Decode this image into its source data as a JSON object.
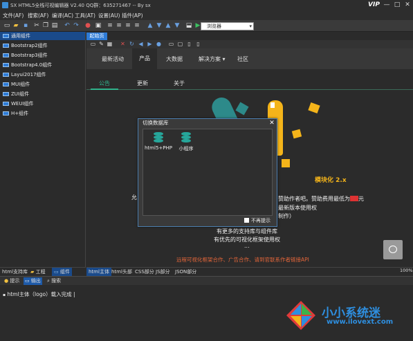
{
  "window": {
    "title": "SX HTML5全栈可视编辑器 V2.40 QQ群：635271467 -- By sx",
    "vip_label": "VIP",
    "controls": [
      "—",
      "□",
      "✕"
    ]
  },
  "menu": [
    "文件(AF)",
    "搜索(AF)",
    "编译(AC)",
    "工具(AT)",
    "设置(AU)",
    "插件(AP)"
  ],
  "toolbar": {
    "browser_select": "浏览器"
  },
  "sidebar": {
    "items": [
      {
        "label": "通用组件"
      },
      {
        "label": "Bootstrap2组件"
      },
      {
        "label": "Bootstrap3组件"
      },
      {
        "label": "Bootstrap4.0组件"
      },
      {
        "label": "Layui2017组件"
      },
      {
        "label": "MUI组件"
      },
      {
        "label": "ZUI组件"
      },
      {
        "label": "WEUI组件"
      },
      {
        "label": "H+组件"
      }
    ],
    "tabs": [
      "html支持库",
      "工程",
      "组件"
    ]
  },
  "editor": {
    "doc_tab": "起始页",
    "zoom_readout": "100%",
    "bottom_tabs": [
      "html主体",
      "html头部",
      "CSS部分",
      "JS部分",
      "JSON部分"
    ]
  },
  "preview": {
    "nav": [
      "最新活动",
      "产品",
      "大数据",
      "解决方案 ▾",
      "社区"
    ],
    "subtabs": [
      "公告",
      "更新",
      "关于"
    ],
    "badge": "模块化 2.x",
    "text_right_1": "赞助作者吧。赞助费用最低为",
    "text_right_1b": "元",
    "text_right_2": "最新版本使用权",
    "text_right_3": "制作）",
    "text_left_1": "允",
    "text_center_1": "有更多的支持库与组件库",
    "text_center_2": "有优先的可视化框架使用权",
    "text_center_3": "...",
    "footer_note": "远程可视化框架合作、广告合作、请到官联系作者链接API"
  },
  "dialog": {
    "title": "切换数据库",
    "items": [
      "html5+PHP",
      "小程序"
    ],
    "checkbox": "不再提示"
  },
  "output": {
    "tabs": [
      "提示",
      "输出",
      "搜索"
    ],
    "line": "html主体（logo）载入完成 |"
  },
  "watermark": {
    "line1": "小小系统迷",
    "line2": "www.ilovext.com"
  }
}
